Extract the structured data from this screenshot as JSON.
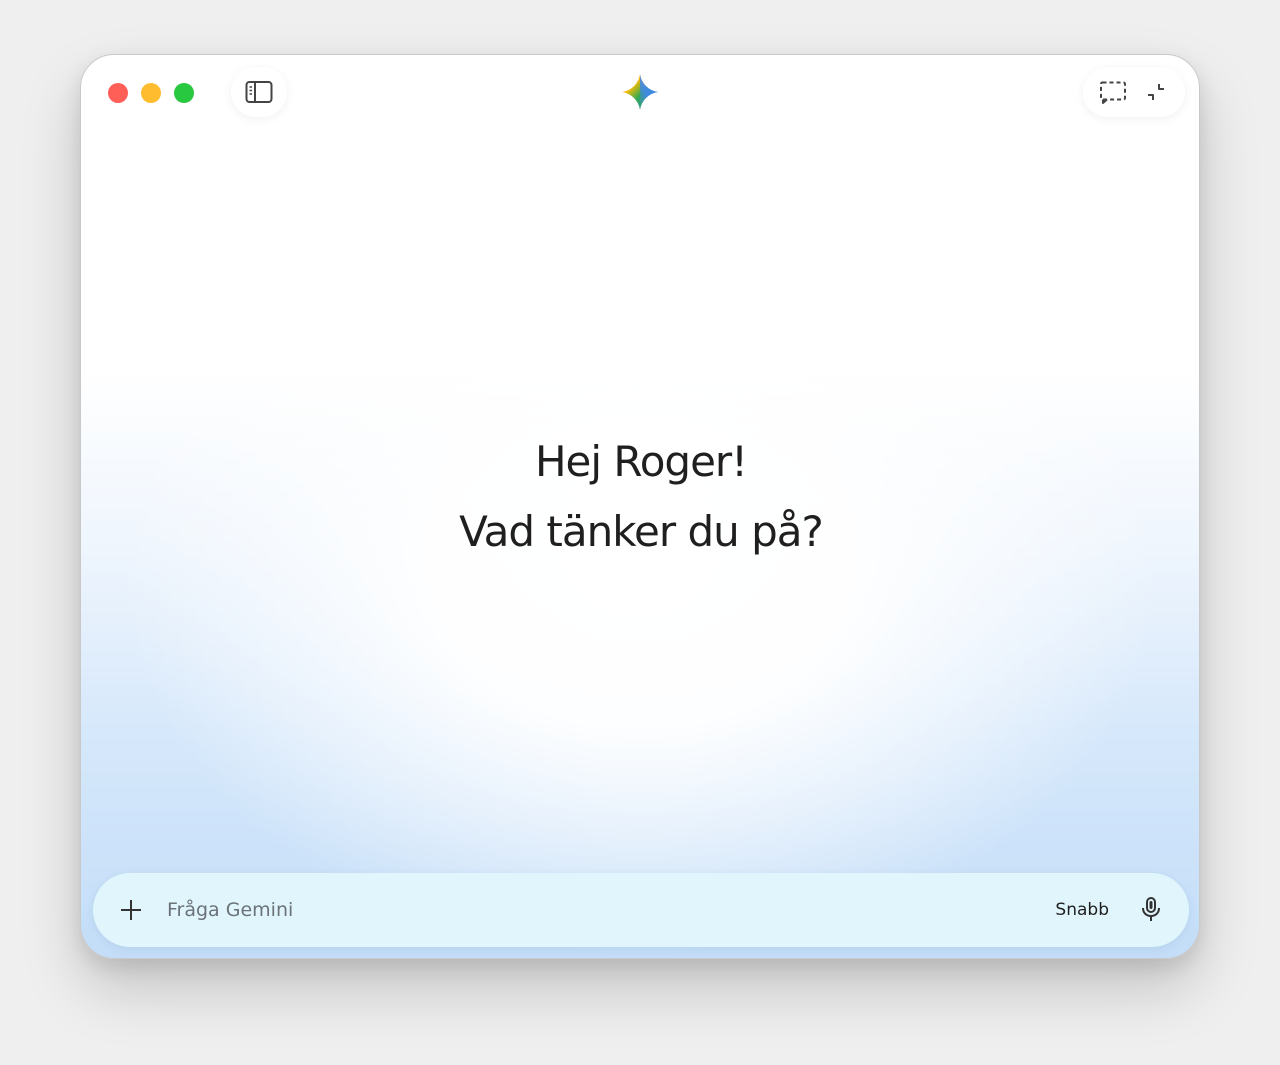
{
  "window": {
    "traffic_lights": [
      "close",
      "minimize",
      "zoom"
    ],
    "colors": {
      "close": "#ff5f57",
      "minimize": "#febc2e",
      "zoom": "#28c840",
      "input_bg": "#e0f6fc",
      "gradient_bottom": "#c3ddf8"
    }
  },
  "toolbar": {
    "sidebar_icon": "sidebar-toggle-icon",
    "logo_icon": "gemini-sparkle-icon",
    "right_icons": [
      "screen-capture-icon",
      "minimize-window-icon"
    ]
  },
  "greeting": {
    "line1": "Hej Roger!",
    "line2": "Vad tänker du på?"
  },
  "input": {
    "placeholder": "Fråga Gemini",
    "value": "",
    "add_icon": "plus-icon",
    "mode_label": "Snabb",
    "mic_icon": "microphone-icon"
  }
}
